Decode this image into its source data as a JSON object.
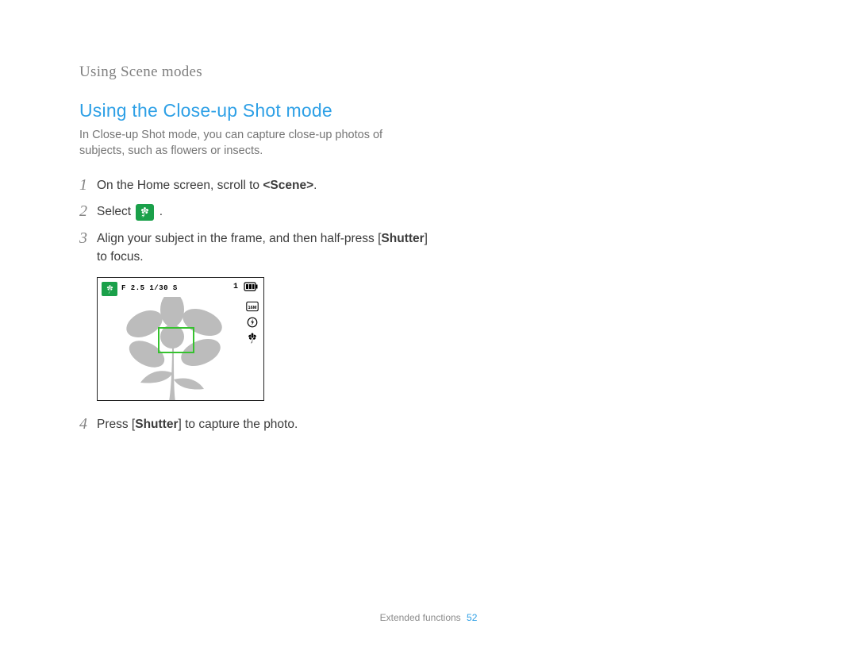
{
  "section_header": "Using Scene modes",
  "title": "Using the Close-up Shot mode",
  "intro": "In Close-up Shot mode, you can capture close-up photos of subjects, such as flowers or insects.",
  "steps": [
    {
      "num": "1",
      "parts": [
        {
          "t": "On the Home screen, scroll to "
        },
        {
          "t": "<Scene>",
          "bold": true
        },
        {
          "t": "."
        }
      ]
    },
    {
      "num": "2",
      "parts": [
        {
          "t": "Select "
        },
        {
          "icon": "closeup-mode-icon"
        },
        {
          "t": "."
        }
      ]
    },
    {
      "num": "3",
      "parts": [
        {
          "t": "Align your subject in the frame, and then half-press ["
        },
        {
          "t": "Shutter",
          "bold": true
        },
        {
          "t": "] to focus."
        }
      ]
    },
    {
      "num": "4",
      "parts": [
        {
          "t": "Press ["
        },
        {
          "t": "Shutter",
          "bold": true
        },
        {
          "t": "] to capture the photo."
        }
      ]
    }
  ],
  "lcd": {
    "exposure": "F 2.5 1/30 S",
    "shots_remaining": "1"
  },
  "footer": {
    "label": "Extended functions",
    "page": "52"
  }
}
